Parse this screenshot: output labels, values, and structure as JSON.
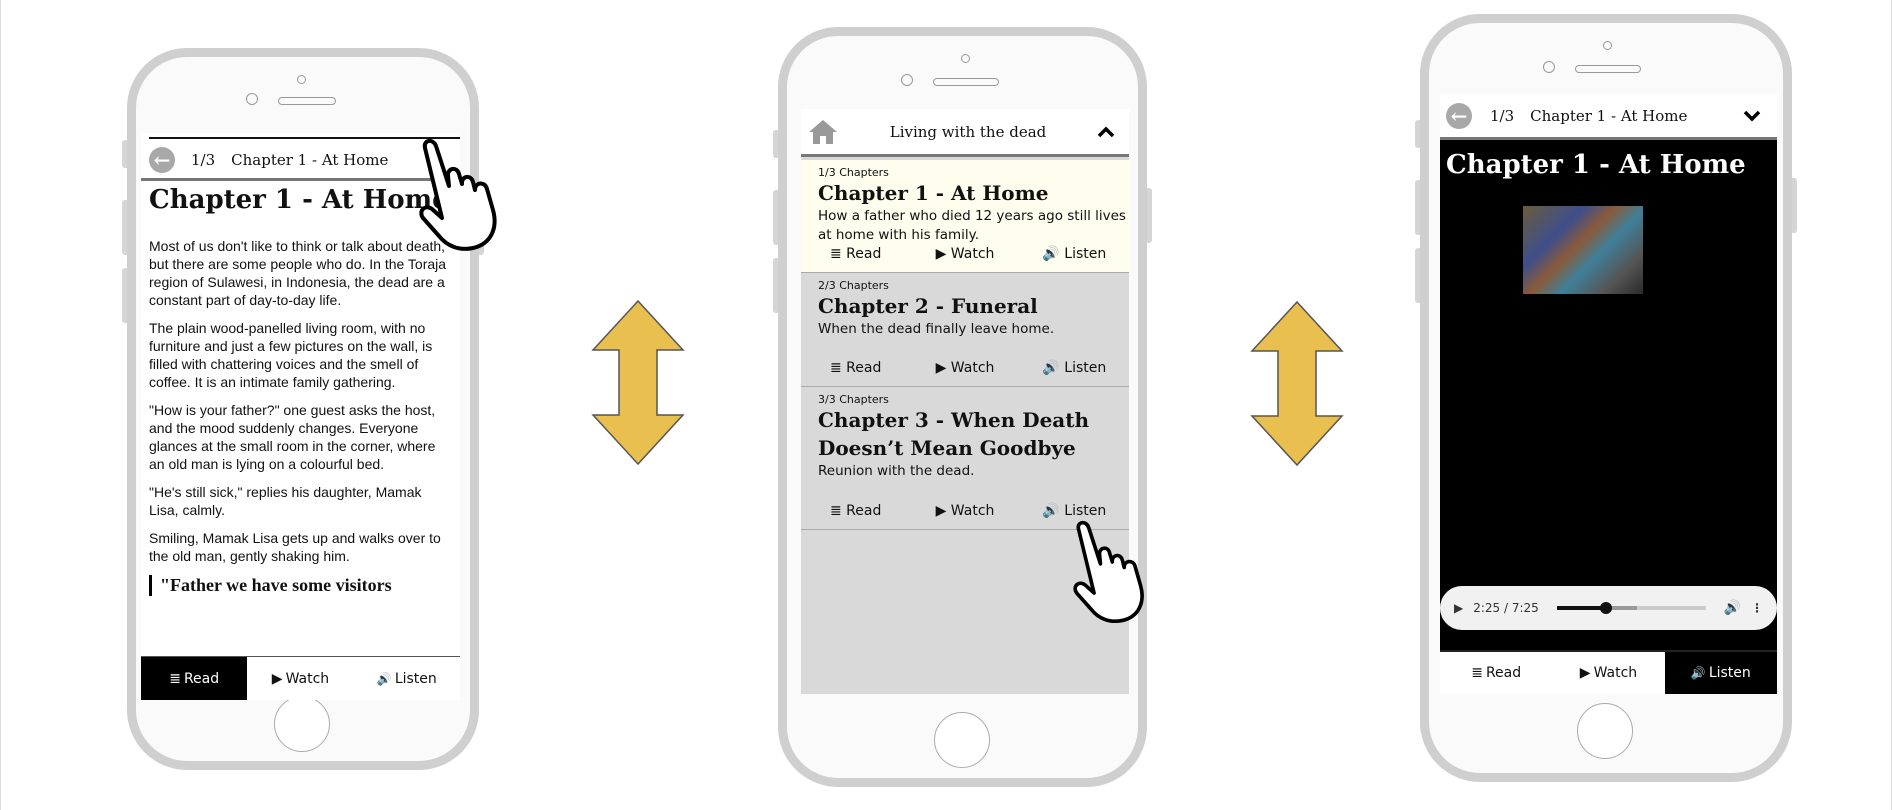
{
  "colors": {
    "arrow": "#e9bf4f",
    "highlight": "#fefdee",
    "chapter_bg": "#d9d9d9"
  },
  "icons": {
    "back": "arrow-left-circle-icon",
    "home": "home-icon",
    "chevron_up": "chevron-up-icon",
    "chevron_down": "chevron-down-icon",
    "read": "list-icon",
    "watch": "play-icon",
    "listen": "speaker-icon",
    "pointer": "pointing-hand-icon",
    "swap": "double-arrow-icon"
  },
  "tabs": {
    "read": "Read",
    "watch": "Watch",
    "listen": "Listen",
    "read_icon": "≣",
    "watch_icon": "▶",
    "listen_icon": "🔊"
  },
  "reader": {
    "progress": "1/3",
    "chapter": "Chapter 1 - At Home",
    "title": "Chapter 1 - At Home",
    "paragraphs": [
      "Most of us don't like to think or talk about death, but there are some people who do. In the Toraja region of Sulawesi, in Indonesia, the dead are a constant part of day-to-day life.",
      "The plain wood-panelled living room, with no furniture and just a few pictures on the wall, is filled with chattering voices and the smell of coffee. It is an intimate family gathering.",
      "\"How is your father?\" one guest asks the host, and the mood suddenly changes. Everyone glances at the small room in the corner, where an old man is lying on a colourful bed.",
      "\"He's still sick,\" replies his daughter, Mamak Lisa, calmly.",
      "Smiling, Mamak Lisa gets up and walks over to the old man, gently shaking him."
    ],
    "quote": "\"Father we have some visitors",
    "active_tab": "read"
  },
  "menu": {
    "title": "Living with the dead",
    "chapters": [
      {
        "count": "1/3 Chapters",
        "title": "Chapter 1 - At Home",
        "desc": "How a father who died 12 years ago still lives at home with his family.",
        "current": true
      },
      {
        "count": "2/3 Chapters",
        "title": "Chapter 2 - Funeral",
        "desc": "When the dead finally leave home.",
        "current": false
      },
      {
        "count": "3/3 Chapters",
        "title": "Chapter 3 - When Death Doesn’t Mean Goodbye",
        "desc": "Reunion with the dead.",
        "current": false
      }
    ]
  },
  "player": {
    "progress": "1/3",
    "chapter": "Chapter 1 - At Home",
    "title": "Chapter 1 - At Home",
    "time": "2:25 / 7:25",
    "played_fraction": 0.33,
    "buffered_fraction": 0.54,
    "active_tab": "listen"
  }
}
